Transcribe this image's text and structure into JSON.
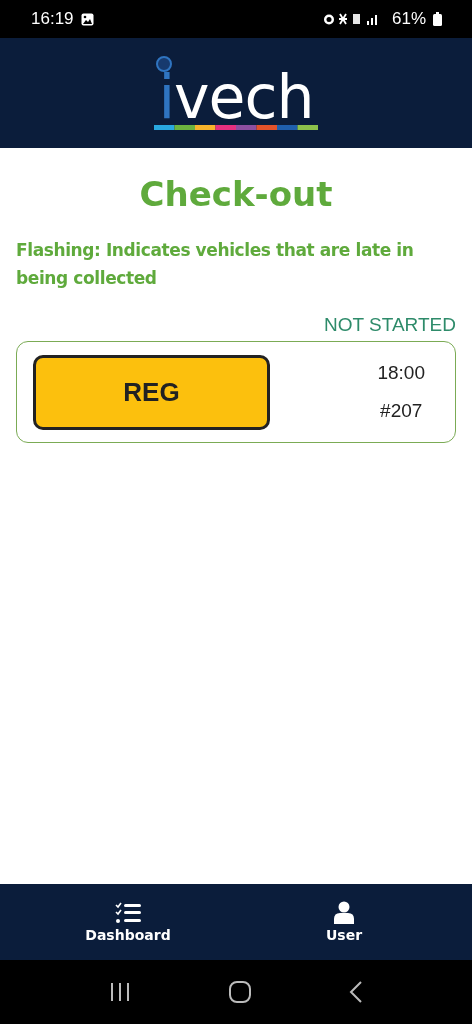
{
  "status_bar": {
    "time": "16:19",
    "battery": "61%"
  },
  "header": {
    "logo": "ivech"
  },
  "page": {
    "title": "Check-out",
    "note": "Flashing: Indicates vehicles that are late in being collected"
  },
  "bookings": [
    {
      "status": "NOT STARTED",
      "reg": "REG",
      "time": "18:00",
      "number": "#207"
    }
  ],
  "nav": [
    {
      "kind": "dashboard",
      "label": "Dashboard"
    },
    {
      "kind": "user",
      "label": "User"
    }
  ]
}
